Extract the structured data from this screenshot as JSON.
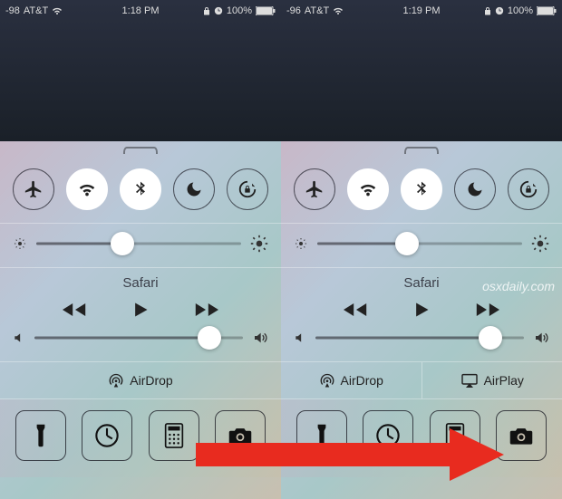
{
  "left": {
    "status": {
      "signal": "-98",
      "carrier": "AT&T",
      "time": "1:18 PM",
      "battery": "100%"
    },
    "brightness_pct": 42,
    "media_title": "Safari",
    "volume_pct": 84,
    "airdrop_label": "AirDrop"
  },
  "right": {
    "status": {
      "signal": "-96",
      "carrier": "AT&T",
      "time": "1:19 PM",
      "battery": "100%"
    },
    "brightness_pct": 44,
    "media_title": "Safari",
    "volume_pct": 84,
    "airdrop_label": "AirDrop",
    "airplay_label": "AirPlay"
  },
  "watermark": "osxdaily.com"
}
